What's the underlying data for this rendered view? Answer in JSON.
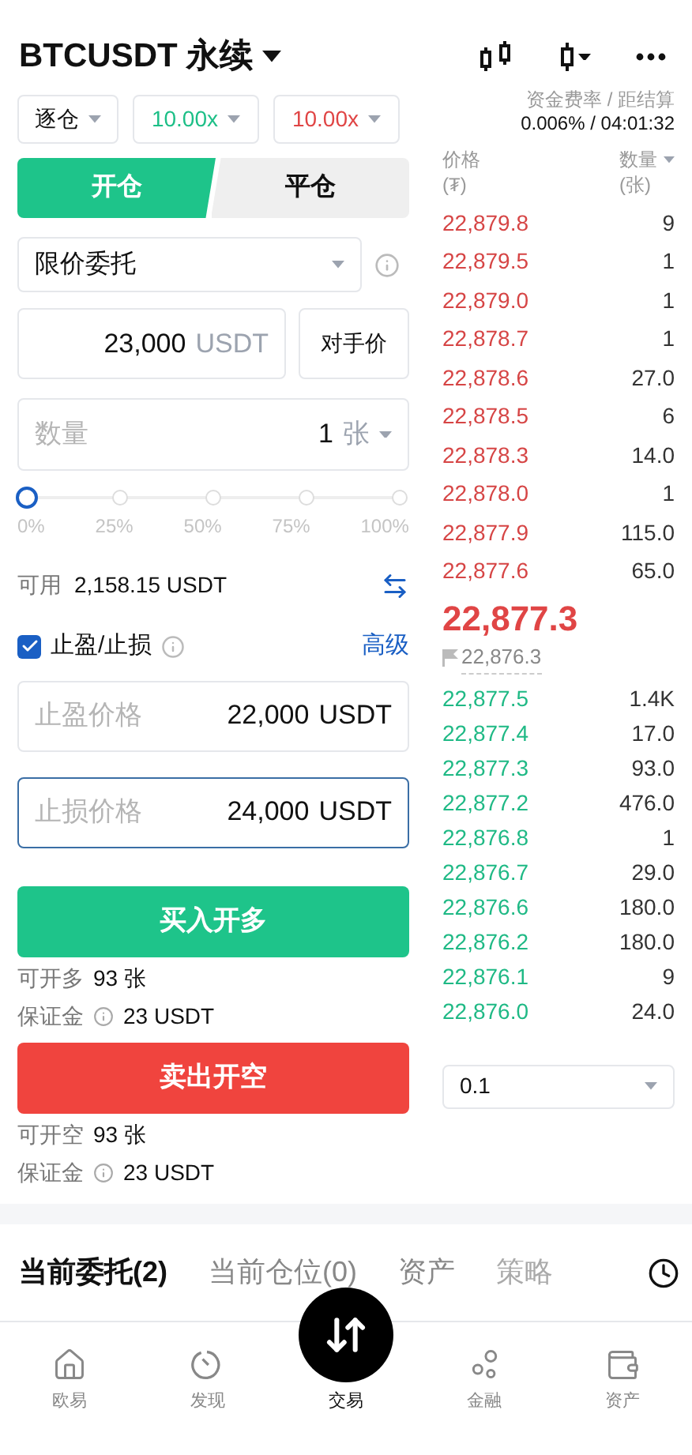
{
  "header": {
    "title": "BTCUSDT 永续"
  },
  "settings": {
    "margin_mode": "逐仓",
    "leverage_long": "10.00x",
    "leverage_short": "10.00x"
  },
  "funding": {
    "label": "资金费率 / 距结算",
    "value": "0.006% / 04:01:32"
  },
  "side_tabs": [
    {
      "label": "开仓",
      "selected": true
    },
    {
      "label": "平仓",
      "selected": false
    }
  ],
  "order_type": "限价委托",
  "price": {
    "value": "23,000",
    "unit": "USDT",
    "button": "对手价"
  },
  "quantity": {
    "placeholder": "数量",
    "value": "1",
    "unit": "张"
  },
  "slider": {
    "level": 0,
    "ticks": [
      "0%",
      "25%",
      "50%",
      "75%",
      "100%"
    ]
  },
  "available": {
    "label": "可用",
    "value": "2,158.15 USDT"
  },
  "tpsl": {
    "label": "止盈/止损",
    "checked": true,
    "advanced": "高级"
  },
  "tp_sl_fields": [
    {
      "placeholder": "止盈价格",
      "value": "22,000",
      "unit": "USDT",
      "focused": false
    },
    {
      "placeholder": "止损价格",
      "value": "24,000",
      "unit": "USDT",
      "focused": true
    }
  ],
  "actions": [
    {
      "kind": "buy",
      "label": "买入开多",
      "max_label": "可开多",
      "max_value": "93 张",
      "margin_label": "保证金",
      "margin_value": "23 USDT"
    },
    {
      "kind": "sell",
      "label": "卖出开空",
      "max_label": "可开空",
      "max_value": "93 张",
      "margin_label": "保证金",
      "margin_value": "23 USDT"
    }
  ],
  "orderbook": {
    "price_label": "价格",
    "price_unit": "(₮)",
    "qty_label": "数量",
    "qty_unit": "(张)",
    "asks": [
      {
        "price": "22,879.8",
        "qty": "9"
      },
      {
        "price": "22,879.5",
        "qty": "1"
      },
      {
        "price": "22,879.0",
        "qty": "1"
      },
      {
        "price": "22,878.7",
        "qty": "1"
      },
      {
        "price": "22,878.6",
        "qty": "27.0"
      },
      {
        "price": "22,878.5",
        "qty": "6"
      },
      {
        "price": "22,878.3",
        "qty": "14.0"
      },
      {
        "price": "22,878.0",
        "qty": "1"
      },
      {
        "price": "22,877.9",
        "qty": "115.0"
      },
      {
        "price": "22,877.6",
        "qty": "65.0"
      }
    ],
    "last_price": "22,877.3",
    "mark_price": "22,876.3",
    "bids": [
      {
        "price": "22,877.5",
        "qty": "1.4K"
      },
      {
        "price": "22,877.4",
        "qty": "17.0"
      },
      {
        "price": "22,877.3",
        "qty": "93.0"
      },
      {
        "price": "22,877.2",
        "qty": "476.0"
      },
      {
        "price": "22,876.8",
        "qty": "1"
      },
      {
        "price": "22,876.7",
        "qty": "29.0"
      },
      {
        "price": "22,876.6",
        "qty": "180.0"
      },
      {
        "price": "22,876.2",
        "qty": "180.0"
      },
      {
        "price": "22,876.1",
        "qty": "9"
      },
      {
        "price": "22,876.0",
        "qty": "24.0"
      }
    ],
    "depth": "0.1"
  },
  "bottom_tabs": [
    {
      "label": "当前委托(2)",
      "selected": true
    },
    {
      "label": "当前仓位(0)",
      "selected": false
    },
    {
      "label": "资产",
      "selected": false
    },
    {
      "label": "策略",
      "selected": false
    }
  ],
  "nav": [
    {
      "kind": "home",
      "label": "欧易",
      "selected": false
    },
    {
      "kind": "discover",
      "label": "发现",
      "selected": false
    },
    {
      "kind": "trade",
      "label": "交易",
      "selected": true
    },
    {
      "kind": "finance",
      "label": "金融",
      "selected": false
    },
    {
      "kind": "wallet",
      "label": "资产",
      "selected": false
    }
  ]
}
